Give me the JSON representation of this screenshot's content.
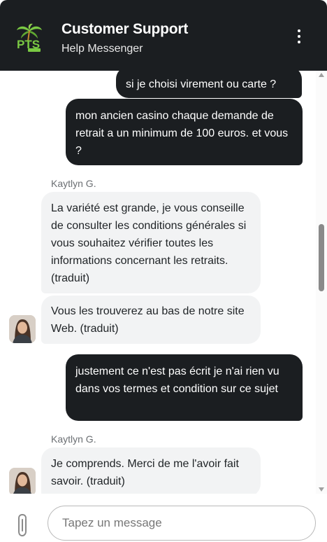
{
  "header": {
    "title": "Customer Support",
    "subtitle": "Help Messenger",
    "logo_icon": "palm-tree-logo-icon",
    "logo_text": "PTS",
    "menu_icon": "kebab-menu-icon"
  },
  "messages": [
    {
      "from": "user",
      "text": "si je choisi virement ou carte ?"
    },
    {
      "from": "user",
      "text": "mon ancien casino chaque demande de retrait a un minimum de 100 euros. et vous ?"
    },
    {
      "from": "agent",
      "sender": "Kaytlyn G.",
      "text": "La variété est grande, je vous conseille de consulter les conditions générales si vous souhaitez vérifier toutes les informations concernant les retraits. (traduit)"
    },
    {
      "from": "agent",
      "text": "Vous les trouverez au bas de notre site Web. (traduit)"
    },
    {
      "from": "user",
      "text": "justement ce n'est pas écrit je n'ai rien vu dans vos termes et condition sur ce sujet"
    },
    {
      "from": "agent",
      "sender": "Kaytlyn G.",
      "text": "Je comprends. Merci de me l'avoir fait savoir. (traduit)"
    }
  ],
  "composer": {
    "placeholder": "Tapez un message",
    "attach_icon": "paperclip-icon"
  },
  "colors": {
    "header_bg": "#1b1e21",
    "user_bubble": "#1b1e21",
    "agent_bubble": "#f2f3f4",
    "logo_green": "#7ac943"
  }
}
